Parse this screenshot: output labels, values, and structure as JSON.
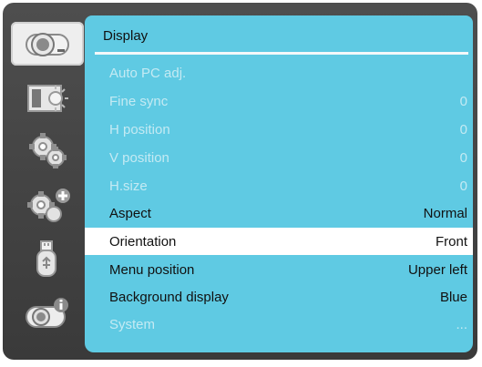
{
  "sidebar": {
    "items": [
      {
        "icon": "projector-icon",
        "selected": true
      },
      {
        "icon": "picture-brightness-icon",
        "selected": false
      },
      {
        "icon": "settings-gear-icon",
        "selected": false
      },
      {
        "icon": "expanded-settings-gear-plus-icon",
        "selected": false
      },
      {
        "icon": "usb-drive-icon",
        "selected": false
      },
      {
        "icon": "projector-info-icon",
        "selected": false
      }
    ]
  },
  "panel": {
    "title": "Display",
    "rows": [
      {
        "label": "Auto PC adj.",
        "value": "",
        "state": "disabled"
      },
      {
        "label": "Fine sync",
        "value": "0",
        "state": "disabled"
      },
      {
        "label": "H position",
        "value": "0",
        "state": "disabled"
      },
      {
        "label": "V position",
        "value": "0",
        "state": "disabled"
      },
      {
        "label": "H.size",
        "value": "0",
        "state": "disabled"
      },
      {
        "label": "Aspect",
        "value": "Normal",
        "state": "enabled"
      },
      {
        "label": "Orientation",
        "value": "Front",
        "state": "highlighted"
      },
      {
        "label": "Menu position",
        "value": "Upper left",
        "state": "enabled"
      },
      {
        "label": "Background display",
        "value": "Blue",
        "state": "enabled"
      },
      {
        "label": "System",
        "value": "...",
        "state": "disabled"
      }
    ]
  },
  "colors": {
    "panel_background": "#5fcae3",
    "frame": "#444444",
    "disabled_text": "#c4eaf3",
    "highlight_row": "#ffffff"
  }
}
